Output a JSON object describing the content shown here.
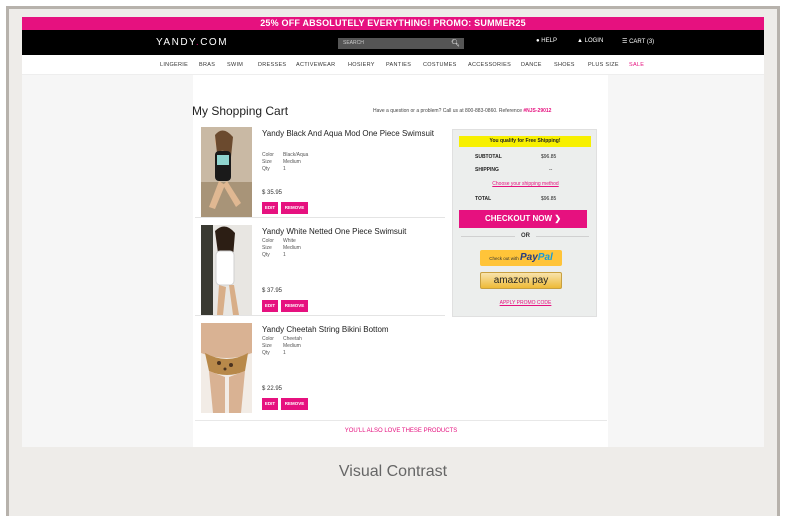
{
  "promo_banner": "25% OFF ABSOLUTELY EVERYTHING! PROMO: SUMMER25",
  "header": {
    "logo_left": "YANDY",
    "logo_dot": ".",
    "logo_right": "COM",
    "search_placeholder": "SEARCH",
    "help": "HELP",
    "login": "LOGIN",
    "cart": "CART (3)"
  },
  "nav": [
    "LINGERIE",
    "BRAS",
    "SWIM",
    "DRESSES",
    "ACTIVEWEAR",
    "HOSIERY",
    "PANTIES",
    "COSTUMES",
    "ACCESSORIES",
    "DANCE",
    "SHOES",
    "PLUS SIZE",
    "SALE"
  ],
  "cart": {
    "title": "My Shopping Cart",
    "help_text": "Have a question or a problem? Call us at 800-883-0860. Reference ",
    "reference": "#NJS-29012",
    "items": [
      {
        "name": "Yandy Black And Aqua Mod One Piece Swimsuit",
        "color_label": "Color",
        "color": "Black/Aqua",
        "size_label": "Size",
        "size": "Medium",
        "qty_label": "Qty",
        "qty": "1",
        "price": "$ 35.95",
        "edit": "EDIT",
        "remove": "REMOVE"
      },
      {
        "name": "Yandy White Netted One Piece Swimsuit",
        "color_label": "Color",
        "color": "White",
        "size_label": "Size",
        "size": "Medium",
        "qty_label": "Qty",
        "qty": "1",
        "price": "$ 37.95",
        "edit": "EDIT",
        "remove": "REMOVE"
      },
      {
        "name": "Yandy Cheetah String Bikini Bottom",
        "color_label": "Color",
        "color": "Cheetah",
        "size_label": "Size",
        "size": "Medium",
        "qty_label": "Qty",
        "qty": "1",
        "price": "$ 22.95",
        "edit": "EDIT",
        "remove": "REMOVE"
      }
    ]
  },
  "summary": {
    "free_shipping": "You qualify for Free Shipping!",
    "subtotal_label": "SUBTOTAL",
    "subtotal": "$96.85",
    "shipping_label": "SHIPPING",
    "shipping": "--",
    "choose_shipping": "Choose your shipping method",
    "total_label": "TOTAL",
    "total": "$96.85",
    "checkout": "CHECKOUT NOW",
    "or": "OR",
    "paypal_prefix": "Check out with",
    "paypal_a": "Pay",
    "paypal_b": "Pal",
    "amazon": "amazon pay",
    "apply_promo": "APPLY PROMO CODE"
  },
  "also_love": "YOU'LL ALSO LOVE THESE PRODUCTS",
  "caption": "Visual Contrast",
  "colors": {
    "brand": "#e6117f",
    "yellow": "#f7f000"
  }
}
